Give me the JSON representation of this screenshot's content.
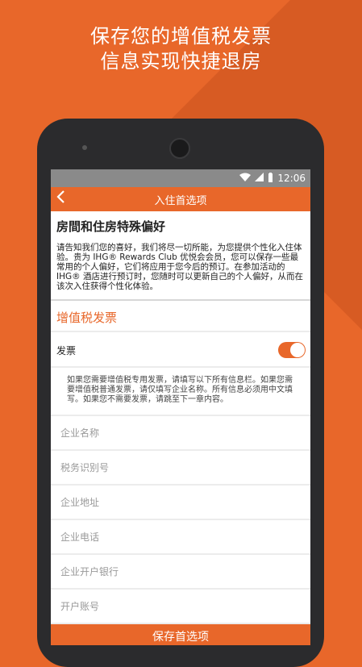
{
  "promo": {
    "line1": "保存您的增值税发票",
    "line2": "信息实现快捷退房"
  },
  "status_bar": {
    "time": "12:06"
  },
  "app_bar": {
    "title": "入住首选项",
    "back_icon": "chevron-left-icon"
  },
  "preferences": {
    "title": "房間和住房特殊偏好",
    "description": "请告知我们您的喜好，我们将尽一切所能，为您提供个性化入住体验。贵为 IHG® Rewards Club 优悦会会员，您可以保存一些最常用的个人偏好，它们将应用于您今后的预订。在参加活动的 IHG® 酒店进行预订时，您随时可以更新自己的个人偏好，从而在该次入住获得个性化体验。"
  },
  "vat": {
    "title": "增值税发票",
    "invoice_label": "发票",
    "invoice_enabled": true,
    "note": "如果您需要增值税专用发票，请填写以下所有信息栏。如果您需要增值税普通发票，请仅填写企业名称。所有信息必须用中文填写。如果您不需要发票，请跳至下一章内容。",
    "fields": [
      {
        "placeholder": "企业名称",
        "value": ""
      },
      {
        "placeholder": "税务识别号",
        "value": ""
      },
      {
        "placeholder": "企业地址",
        "value": ""
      },
      {
        "placeholder": "企业电话",
        "value": ""
      },
      {
        "placeholder": "企业开户银行",
        "value": ""
      },
      {
        "placeholder": "开户账号",
        "value": ""
      }
    ]
  },
  "save_label": "保存首选项",
  "colors": {
    "accent": "#e8672a",
    "status_bar": "#8a8a8a"
  }
}
